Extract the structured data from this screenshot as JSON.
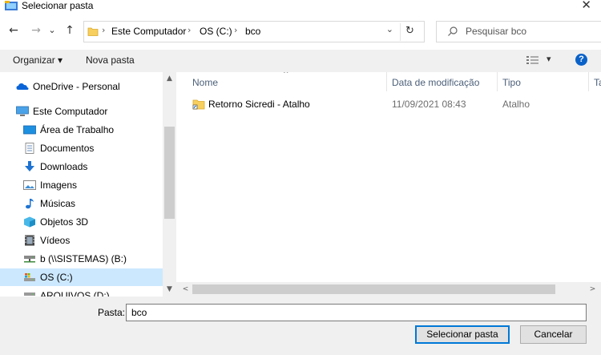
{
  "window": {
    "title": "Selecionar pasta",
    "close_glyph": "✕"
  },
  "nav": {
    "back_glyph": "←",
    "forward_glyph": "→",
    "recent_glyph": "⌄",
    "up_glyph": "↑",
    "breadcrumbs": [
      "Este Computador",
      "OS (C:)",
      "bco"
    ],
    "separator_glyph": "›",
    "dropdown_glyph": "⌄",
    "refresh_glyph": "↻",
    "search_placeholder": "Pesquisar bco"
  },
  "toolbar": {
    "organize_label": "Organizar ▾",
    "new_folder_label": "Nova pasta",
    "help_label": "?",
    "view_dropdown_glyph": "▾"
  },
  "sidebar": {
    "items": [
      {
        "label": "OneDrive - Personal",
        "icon": "onedrive-icon"
      },
      {
        "label": "Este Computador",
        "icon": "computer-icon"
      },
      {
        "label": "Área de Trabalho",
        "icon": "desktop-icon"
      },
      {
        "label": "Documentos",
        "icon": "documents-icon"
      },
      {
        "label": "Downloads",
        "icon": "downloads-icon"
      },
      {
        "label": "Imagens",
        "icon": "pictures-icon"
      },
      {
        "label": "Músicas",
        "icon": "music-icon"
      },
      {
        "label": "Objetos 3D",
        "icon": "objects-3d-icon"
      },
      {
        "label": "Vídeos",
        "icon": "videos-icon"
      },
      {
        "label": "b (\\\\SISTEMAS) (B:)",
        "icon": "network-drive-icon"
      },
      {
        "label": "OS (C:)",
        "icon": "drive-c-icon",
        "selected": true
      },
      {
        "label": "ARQUIVOS (D:)",
        "icon": "drive-d-icon"
      }
    ],
    "scroll_up_glyph": "▲",
    "scroll_down_glyph": "▼"
  },
  "files": {
    "columns": [
      "Nome",
      "Data de modificação",
      "Tipo",
      "Ta"
    ],
    "sort_glyph": "^",
    "rows": [
      {
        "name": "Retorno Sicredi - Atalho",
        "modified": "11/09/2021 08:43",
        "type": "Atalho"
      }
    ],
    "scroll_left_glyph": "<",
    "scroll_right_glyph": ">"
  },
  "footer": {
    "folder_label": "Pasta:",
    "folder_value": "bco",
    "select_button": "Selecionar pasta",
    "cancel_button": "Cancelar"
  },
  "colors": {
    "accent": "#0078d7",
    "selection": "#cce8ff",
    "help": "#0a62c9",
    "header_text": "#4c607a"
  }
}
